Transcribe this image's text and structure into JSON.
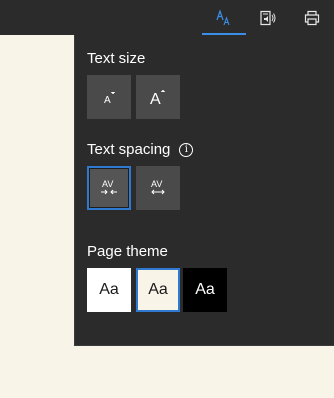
{
  "toolbar": {
    "items": [
      {
        "name": "text-options-icon",
        "active": true
      },
      {
        "name": "read-aloud-icon",
        "active": false
      },
      {
        "name": "print-icon",
        "active": false
      }
    ],
    "accent_color": "#3a8ee6"
  },
  "panel": {
    "text_size": {
      "title": "Text size",
      "buttons": [
        {
          "name": "decrease-text-size-button",
          "icon": "small-a-down-icon"
        },
        {
          "name": "increase-text-size-button",
          "icon": "large-a-up-icon"
        }
      ]
    },
    "text_spacing": {
      "title": "Text spacing",
      "info_glyph": "i",
      "buttons": [
        {
          "name": "narrow-spacing-button",
          "icon": "narrow-spacing-icon",
          "selected": true
        },
        {
          "name": "wide-spacing-button",
          "icon": "wide-spacing-icon",
          "selected": false
        }
      ]
    },
    "page_theme": {
      "title": "Page theme",
      "options": [
        {
          "label": "Aa",
          "theme": "light",
          "color": "#ffffff",
          "selected": false
        },
        {
          "label": "Aa",
          "theme": "sepia",
          "color": "#f8f4e8",
          "selected": true
        },
        {
          "label": "Aa",
          "theme": "dark",
          "color": "#000000",
          "selected": false
        }
      ]
    }
  },
  "colors": {
    "panel_bg": "#2b2b2b",
    "button_bg": "#4a4a4a",
    "selection_border": "#2f7ad0",
    "page_bg": "#f8f4e8"
  }
}
